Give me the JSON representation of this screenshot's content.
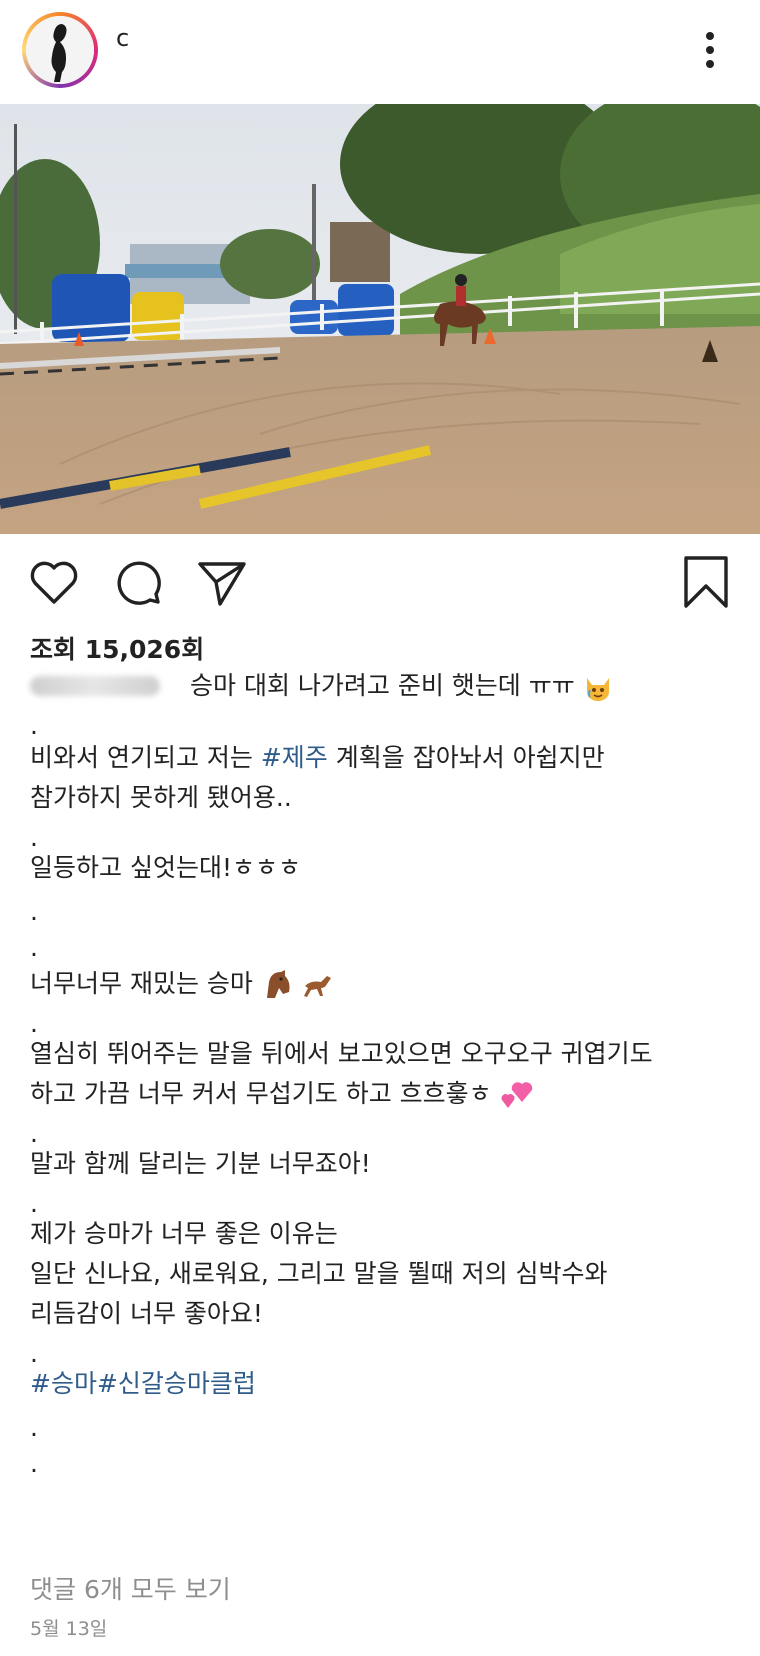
{
  "header": {
    "username": "c",
    "more_icon": "more-vertical-icon"
  },
  "photo": {
    "icon": "photo-horse-riding-arena"
  },
  "actions": {
    "like_icon": "heart-icon",
    "comment_icon": "comment-icon",
    "share_icon": "send-icon",
    "save_icon": "bookmark-icon"
  },
  "stats": {
    "views_label": "조회",
    "views_count": "15,026회"
  },
  "caption": {
    "first_line": "승마 대회 나가려고 준비 햇는데 ㅠㅠ",
    "line_dot_1": ".",
    "line_2a": "비와서 연기되고 저는 ",
    "line_2_tag": "#제주",
    "line_2b": " 계획을 잡아놔서 아쉽지만",
    "line_3": "참가하지 못하게 됐어용..",
    "line_dot_2": ".",
    "line_4": "일등하고 싶엇는대!ㅎㅎㅎ",
    "line_dot_3": ".",
    "line_dot_4": ".",
    "line_5": "너무너무 재밌는 승마",
    "line_dot_5": ".",
    "line_6": "열심히 뛰어주는 말을 뒤에서 보고있으면 오구오구 귀엽기도",
    "line_7": "하고 가끔 너무 커서 무섭기도 하고 흐흐흫ㅎ",
    "line_dot_6": ".",
    "line_8": "말과 함께 달리는 기분 너무죠아!",
    "line_dot_7": ".",
    "line_9": "제가 승마가 너무 좋은 이유는",
    "line_10": "일단 신나요, 새로워요, 그리고 말을 뛸때 저의 심박수와",
    "line_11": "리듬감이 너무 좋아요!",
    "line_dot_8": ".",
    "hashtags": "#승마#신갈승마클럽",
    "line_dot_9": ".",
    "line_dot_10": "."
  },
  "footer": {
    "view_comments": "댓글 6개 모두 보기",
    "date": "5월 13일"
  },
  "colors": {
    "hashtag": "#2f5c8a",
    "muted": "#8e8e8e",
    "text": "#222222"
  }
}
